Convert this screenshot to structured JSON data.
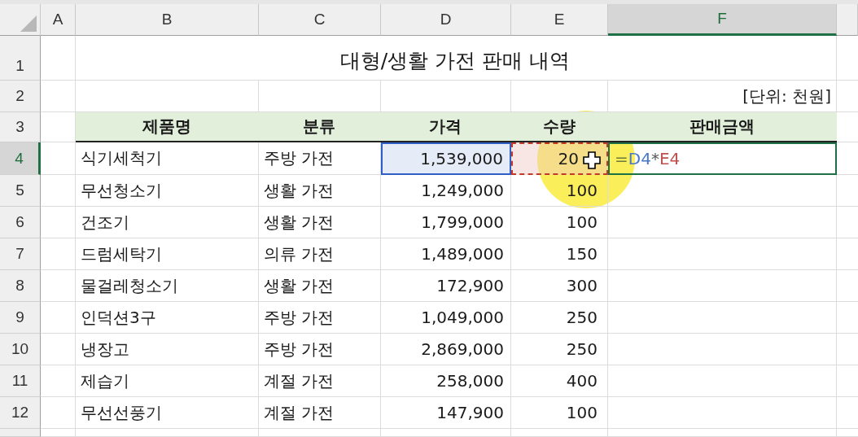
{
  "columns": [
    {
      "label": "A",
      "selected": false
    },
    {
      "label": "B",
      "selected": false
    },
    {
      "label": "C",
      "selected": false
    },
    {
      "label": "D",
      "selected": false
    },
    {
      "label": "E",
      "selected": false
    },
    {
      "label": "F",
      "selected": true
    }
  ],
  "row_numbers": [
    {
      "label": "1",
      "selected": false
    },
    {
      "label": "2",
      "selected": false
    },
    {
      "label": "3",
      "selected": false
    },
    {
      "label": "4",
      "selected": true
    },
    {
      "label": "5",
      "selected": false
    },
    {
      "label": "6",
      "selected": false
    },
    {
      "label": "7",
      "selected": false
    },
    {
      "label": "8",
      "selected": false
    },
    {
      "label": "9",
      "selected": false
    },
    {
      "label": "10",
      "selected": false
    },
    {
      "label": "11",
      "selected": false
    },
    {
      "label": "12",
      "selected": false
    }
  ],
  "title": "대형/생활 가전 판매 내역",
  "unit": "[단위: 천원]",
  "headers": [
    "제품명",
    "분류",
    "가격",
    "수량",
    "판매금액"
  ],
  "rows": [
    {
      "product": "식기세척기",
      "category": "주방 가전",
      "price": "1,539,000",
      "qty": "20",
      "price_referenced": true,
      "qty_referenced": true,
      "formula": [
        {
          "text": "=",
          "color": "#6b7a3a"
        },
        {
          "text": "D4",
          "color": "#4a78c8"
        },
        {
          "text": "*",
          "color": "#555555"
        },
        {
          "text": "E4",
          "color": "#c0504d"
        }
      ]
    },
    {
      "product": "무선청소기",
      "category": "생활 가전",
      "price": "1,249,000",
      "qty": "100"
    },
    {
      "product": "건조기",
      "category": "생활 가전",
      "price": "1,799,000",
      "qty": "100"
    },
    {
      "product": "드럼세탁기",
      "category": "의류 가전",
      "price": "1,489,000",
      "qty": "150"
    },
    {
      "product": "물걸레청소기",
      "category": "생활 가전",
      "price": "172,900",
      "qty": "300"
    },
    {
      "product": "인덕션3구",
      "category": "주방 가전",
      "price": "1,049,000",
      "qty": "250"
    },
    {
      "product": "냉장고",
      "category": "주방 가전",
      "price": "2,869,000",
      "qty": "250"
    },
    {
      "product": "제습기",
      "category": "계절 가전",
      "price": "258,000",
      "qty": "400"
    },
    {
      "product": "무선선풍기",
      "category": "계절 가전",
      "price": "147,900",
      "qty": "100"
    }
  ]
}
